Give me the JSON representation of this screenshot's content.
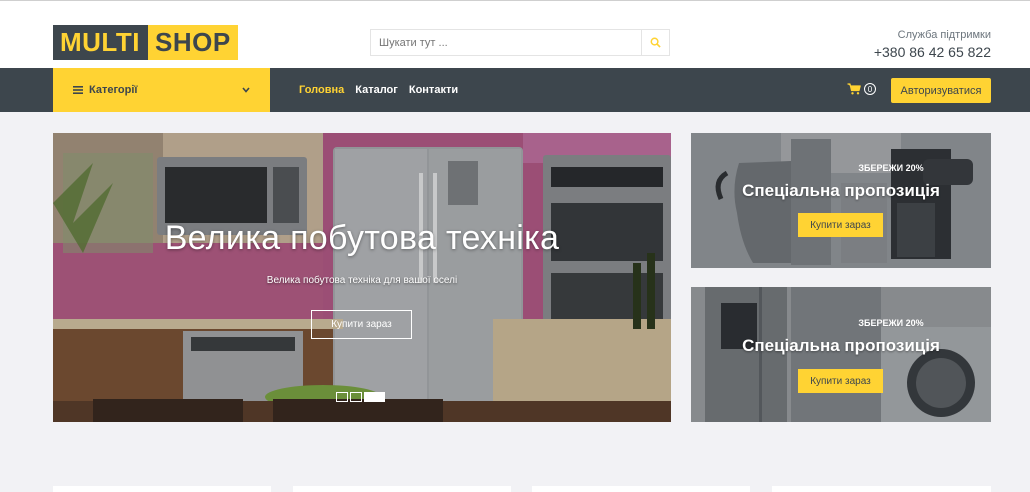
{
  "header": {
    "logo": {
      "part1": "MULTI",
      "part2": "SHOP"
    },
    "search": {
      "placeholder": "Шукати тут ...",
      "icon": "search-icon"
    },
    "support": {
      "label": "Служба підтримки",
      "phone": "+380 86 42 65 822"
    }
  },
  "nav": {
    "categories_label": "Категорії",
    "items": [
      {
        "label": "Головна",
        "active": true
      },
      {
        "label": "Каталог",
        "active": false
      },
      {
        "label": "Контакти",
        "active": false
      }
    ],
    "cart_count": "0",
    "login_label": "Авторизуватися"
  },
  "hero": {
    "title": "Велика побутова техніка",
    "subtitle": "Велика побутова техніка для вашої оселі",
    "cta": "Купити зараз"
  },
  "offers": [
    {
      "discount": "ЗБЕРЕЖИ 20%",
      "title": "Спеціальна пропозиція",
      "cta": "Купити зараз"
    },
    {
      "discount": "ЗБЕРЕЖИ 20%",
      "title": "Спеціальна пропозиція",
      "cta": "Купити зараз"
    }
  ],
  "colors": {
    "accent": "#FFD333",
    "dark": "#3D464D",
    "background": "#F2F2F5"
  }
}
